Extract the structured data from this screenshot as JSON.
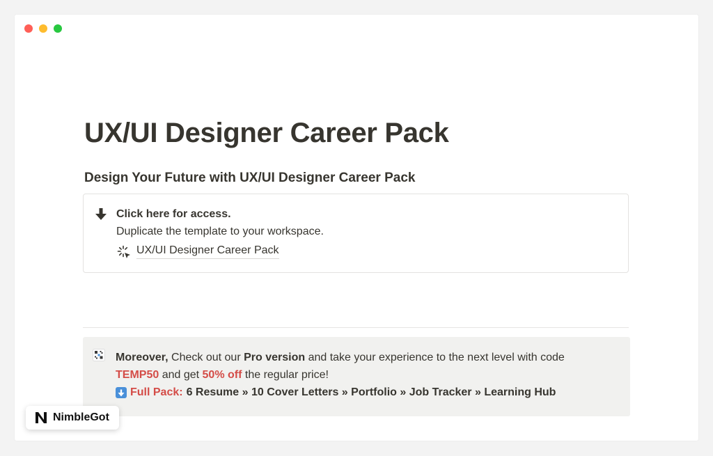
{
  "window": {
    "controls": [
      "close",
      "minimize",
      "zoom"
    ]
  },
  "page": {
    "title": "UX/UI Designer Career Pack",
    "subtitle": "Design Your Future with UX/UI Designer Career Pack"
  },
  "callout": {
    "icon": "arrow-down-icon",
    "heading": "Click here for access.",
    "description": "Duplicate the template to your workspace.",
    "link_icon": "loading-cursor-icon",
    "link_label": "UX/UI Designer Career Pack"
  },
  "promo": {
    "icon": "grid-icon",
    "lead": "Moreover,",
    "text_a": " Check out our ",
    "pro": "Pro version",
    "text_b": " and take your experience to the next level with code ",
    "code": "TEMP50",
    "text_c": " and get ",
    "discount": "50% off",
    "text_d": " the regular price!",
    "pack_icon": "down-arrow-box-icon",
    "pack_label": "Full Pack:",
    "pack_items": "6 Resume » 10 Cover Letters » Portfolio » Job Tracker » Learning Hub"
  },
  "badge": {
    "logo": "N",
    "name": "NimbleGot"
  },
  "colors": {
    "red": "#d44c47",
    "text": "#37352f",
    "promo_bg": "#f1f1ef"
  }
}
